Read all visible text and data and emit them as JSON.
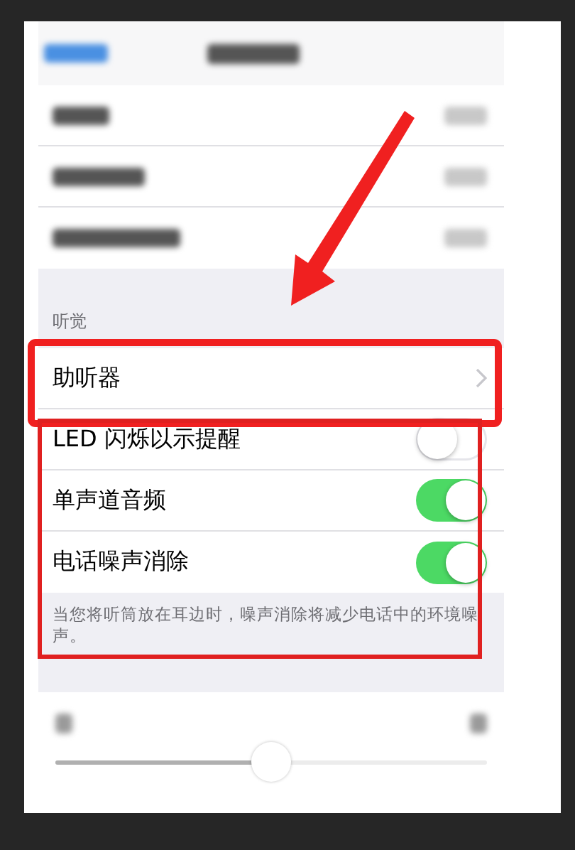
{
  "top_rows": [
    {
      "kind": "disclosure"
    },
    {
      "kind": "disclosure"
    },
    {
      "kind": "disclosure"
    }
  ],
  "hearing": {
    "header": "听觉",
    "rows": [
      {
        "kind": "link",
        "label": "助听器"
      },
      {
        "kind": "switch",
        "label": "LED 闪烁以示提醒",
        "on": false
      },
      {
        "kind": "switch",
        "label": "单声道音频",
        "on": true
      },
      {
        "kind": "switch",
        "label": "电话噪声消除",
        "on": true
      }
    ],
    "footer": "当您将听筒放在耳边时，噪声消除将减少电话中的环境噪声。"
  },
  "balance": {
    "level": 0.5
  }
}
